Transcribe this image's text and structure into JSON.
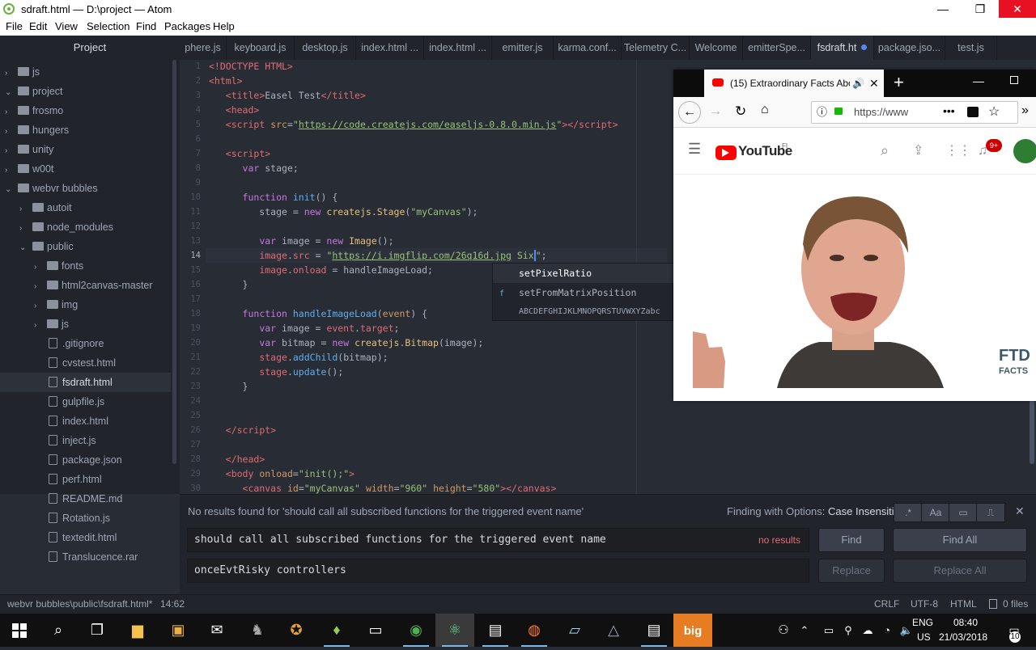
{
  "window": {
    "title": "sdraft.html — D:\\project — Atom",
    "controls": {
      "minimize": "—",
      "maximize": "❐",
      "close": "✕"
    }
  },
  "menu": [
    "File",
    "Edit",
    "View",
    "Selection",
    "Find",
    "Packages",
    "Help"
  ],
  "tree": {
    "title": "Project",
    "items": [
      {
        "label": "js",
        "type": "folder",
        "expanded": false,
        "depth": 0
      },
      {
        "label": "project",
        "type": "folder",
        "expanded": true,
        "depth": 0
      },
      {
        "label": "frosmo",
        "type": "folder",
        "expanded": false,
        "depth": 1
      },
      {
        "label": "hungers",
        "type": "folder",
        "expanded": false,
        "depth": 1
      },
      {
        "label": "unity",
        "type": "folder",
        "expanded": false,
        "depth": 1
      },
      {
        "label": "w00t",
        "type": "folder",
        "expanded": false,
        "depth": 1
      },
      {
        "label": "webvr bubbles",
        "type": "folder",
        "expanded": true,
        "depth": 1
      },
      {
        "label": "autoit",
        "type": "folder",
        "expanded": false,
        "depth": 2
      },
      {
        "label": "node_modules",
        "type": "folder",
        "expanded": false,
        "depth": 2
      },
      {
        "label": "public",
        "type": "folder",
        "expanded": true,
        "depth": 2
      },
      {
        "label": "fonts",
        "type": "folder",
        "expanded": false,
        "depth": 3
      },
      {
        "label": "html2canvas-master",
        "type": "folder",
        "expanded": false,
        "depth": 3
      },
      {
        "label": "img",
        "type": "folder",
        "expanded": false,
        "depth": 3
      },
      {
        "label": "js",
        "type": "folder",
        "expanded": false,
        "depth": 3
      },
      {
        "label": ".gitignore",
        "type": "file",
        "depth": 3
      },
      {
        "label": "cvstest.html",
        "type": "file",
        "depth": 3
      },
      {
        "label": "fsdraft.html",
        "type": "file",
        "depth": 3,
        "selected": true
      },
      {
        "label": "gulpfile.js",
        "type": "file",
        "depth": 3
      },
      {
        "label": "index.html",
        "type": "file",
        "depth": 3
      },
      {
        "label": "inject.js",
        "type": "file",
        "depth": 3
      },
      {
        "label": "package.json",
        "type": "file",
        "depth": 3
      },
      {
        "label": "perf.html",
        "type": "file",
        "depth": 3
      },
      {
        "label": "README.md",
        "type": "file",
        "depth": 3
      },
      {
        "label": "Rotation.js",
        "type": "file",
        "depth": 3
      },
      {
        "label": "textedit.html",
        "type": "file",
        "depth": 3
      },
      {
        "label": "Translucence.rar",
        "type": "file",
        "depth": 3
      }
    ]
  },
  "tabs": [
    {
      "label": "phere.js",
      "active": false
    },
    {
      "label": "keyboard.js",
      "active": false
    },
    {
      "label": "desktop.js",
      "active": false
    },
    {
      "label": "index.html ...",
      "active": false
    },
    {
      "label": "index.html ...",
      "active": false
    },
    {
      "label": "emitter.js",
      "active": false
    },
    {
      "label": "karma.conf...",
      "active": false
    },
    {
      "label": "Telemetry C...",
      "active": false
    },
    {
      "label": "Welcome",
      "active": false
    },
    {
      "label": "emitterSpe...",
      "active": false
    },
    {
      "label": "fsdraft.ht",
      "active": true,
      "modified": true
    },
    {
      "label": "package.jso...",
      "active": false
    },
    {
      "label": "test.js",
      "active": false
    }
  ],
  "editor": {
    "current_line": 14,
    "line_numbers": [
      "1",
      "2",
      "3",
      "4",
      "5",
      "6",
      "7",
      "8",
      "9",
      "10",
      "11",
      "12",
      "13",
      "14",
      "15",
      "16",
      "17",
      "18",
      "19",
      "20",
      "21",
      "22",
      "23",
      "24",
      "25",
      "26",
      "27",
      "28",
      "29",
      "30"
    ],
    "autocomplete": [
      {
        "type": "",
        "text": "setPixelRatio",
        "selected": true
      },
      {
        "type": "f",
        "text": "setFromMatrixPosition",
        "selected": false
      },
      {
        "type": "",
        "text": "ABCDEFGHIJKLMNOPQRSTUVWXYZabc",
        "selected": false
      }
    ]
  },
  "browser": {
    "tab_title": "(15) Extraordinary Facts Abo",
    "url": "https://www",
    "new_tab": "+",
    "youtube": {
      "logo": "YouTube",
      "region": "FI",
      "notifications": "9+",
      "watermark_top": "FTD",
      "watermark_bottom": "FACTS"
    }
  },
  "find": {
    "message": "No results found for 'should call all subscribed functions for the triggered event name'",
    "options_label": "Finding with Options:",
    "options_value": "Case Insensitive",
    "opt_regex": ".*",
    "opt_case": "Aa",
    "find_value": "should call all subscribed functions for the triggered event name",
    "results": "no results",
    "replace_value": "onceEvtRisky controllers",
    "btn_find": "Find",
    "btn_find_all": "Find All",
    "btn_replace": "Replace",
    "btn_replace_all": "Replace All",
    "close": "✕"
  },
  "status": {
    "path": "webvr bubbles\\public\\fsdraft.html*",
    "cursor": "14:62",
    "line_ending": "CRLF",
    "encoding": "UTF-8",
    "grammar": "HTML",
    "files": "0 files"
  },
  "taskbar": {
    "language": "ENG",
    "region": "US",
    "time": "08:40",
    "date": "21/03/2018",
    "notifications": "10",
    "big_label": "big"
  }
}
